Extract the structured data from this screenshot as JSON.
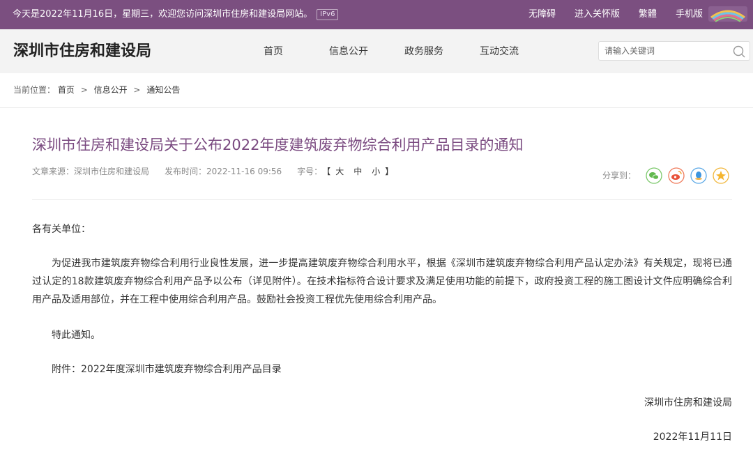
{
  "topbar": {
    "welcome": "今天是2022年11月16日，星期三，欢迎您访问深圳市住房和建设局网站。",
    "ipv6_badge": "IPv6",
    "links": [
      "无障碍",
      "进入关怀版",
      "繁體",
      "手机版"
    ],
    "bg_color": "#7b4f80"
  },
  "header": {
    "site_title": "深圳市住房和建设局",
    "nav": [
      "首页",
      "信息公开",
      "政务服务",
      "互动交流"
    ],
    "search_placeholder": "请输入关键词"
  },
  "breadcrumb": {
    "label": "当前位置：",
    "items": [
      "首页",
      "信息公开",
      "通知公告"
    ],
    "separator": ">"
  },
  "article": {
    "title": "深圳市住房和建设局关于公布2022年度建筑废弃物综合利用产品目录的通知",
    "source": "文章来源：深圳市住房和建设局",
    "publish_time": "发布时间：2022-11-16 09:56",
    "font_size_label": "字号：",
    "font_size_open": "【",
    "font_size_options": [
      "大",
      "中",
      "小"
    ],
    "font_size_close": "】",
    "share_label": "分享到：",
    "share_icons": [
      "wechat-icon",
      "weibo-icon",
      "qq-icon",
      "qzone-icon"
    ],
    "greeting": "各有关单位：",
    "paragraph": "为促进我市建筑废弃物综合利用行业良性发展，进一步提高建筑废弃物综合利用水平，根据《深圳市建筑废弃物综合利用产品认定办法》有关规定，现将已通过认定的18款建筑废弃物综合利用产品予以公布（详见附件）。在技术指标符合设计要求及满足使用功能的前提下，政府投资工程的施工图设计文件应明确综合利用产品及适用部位，并在工程中使用综合利用产品。鼓励社会投资工程优先使用综合利用产品。",
    "notice": "特此通知。",
    "attachment": "附件：2022年度深圳市建筑废弃物综合利用产品目录",
    "signature_org": "深圳市住房和建设局",
    "signature_date": "2022年11月11日",
    "title_color": "#7a4a80"
  }
}
